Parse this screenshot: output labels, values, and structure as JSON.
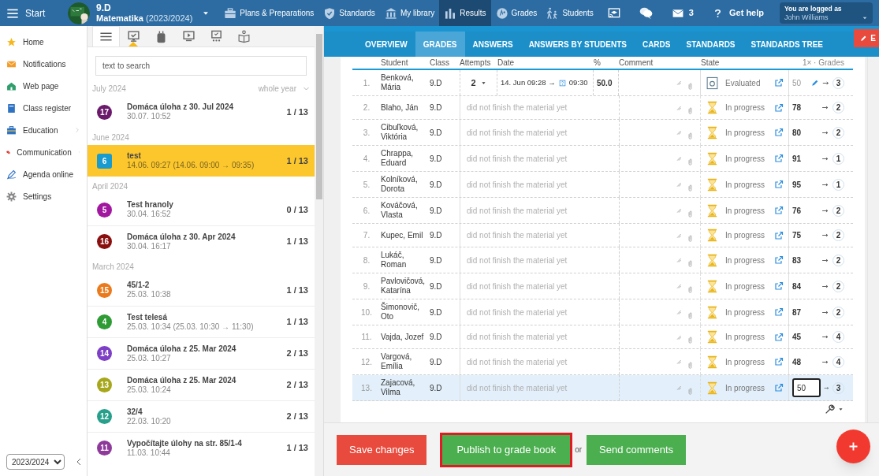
{
  "topbar": {
    "start": "Start",
    "class_name": "9.D",
    "subject": "Matematika",
    "year": "(2023/2024)",
    "nav": [
      {
        "label": "Plans & Preparations",
        "selected": false
      },
      {
        "label": "Standards",
        "selected": false
      },
      {
        "label": "My library",
        "selected": false
      },
      {
        "label": "Results",
        "selected": true
      },
      {
        "label": "Grades",
        "selected": false
      },
      {
        "label": "Students",
        "selected": false
      }
    ],
    "mail_count": "3",
    "help": "Get help",
    "user_caption": "You are logged as",
    "user_name": "John Williams"
  },
  "sidebar": {
    "items": [
      {
        "label": "Home",
        "has_children": false
      },
      {
        "label": "Notifications",
        "has_children": false
      },
      {
        "label": "Web page",
        "has_children": false
      },
      {
        "label": "Class register",
        "has_children": false
      },
      {
        "label": "Education",
        "has_children": true
      },
      {
        "label": "Communication",
        "has_children": true
      },
      {
        "label": "Agenda online",
        "has_children": false
      },
      {
        "label": "Settings",
        "has_children": false
      }
    ],
    "year": "2023/2024"
  },
  "list_panel": {
    "tabs": [
      {
        "selected": true
      },
      {
        "selected": false
      },
      {
        "selected": false
      },
      {
        "selected": false
      },
      {
        "selected": false
      },
      {
        "selected": false
      }
    ],
    "search": {
      "placeholder": "text to search"
    },
    "filter": "whole year",
    "groups": [
      {
        "month": "July 2024",
        "items": [
          {
            "number": "17",
            "color": "#6b1a6b",
            "title": "Domáca úloha z 30. Jul 2024",
            "time": "30.07. 10:52",
            "count": "1 / 13",
            "selected": false
          }
        ]
      },
      {
        "month": "June 2024",
        "items": [
          {
            "number": "6",
            "color": "#1a9bcf",
            "title": "test",
            "time": "14.06. 09:27 (14.06. 09:00 → 09:35)",
            "count": "1 / 13",
            "selected": true
          }
        ]
      },
      {
        "month": "April 2024",
        "items": [
          {
            "number": "5",
            "color": "#a1179f",
            "title": "Test hranoly",
            "time": "30.04. 16:52",
            "count": "0 / 13",
            "selected": false
          },
          {
            "number": "16",
            "color": "#8a1010",
            "title": "Domáca úloha z 30. Apr 2024",
            "time": "30.04. 16:17",
            "count": "1 / 13",
            "selected": false
          }
        ]
      },
      {
        "month": "March 2024",
        "items": [
          {
            "number": "15",
            "color": "#ea7a1c",
            "title": "45/1-2",
            "time": "25.03. 10:38",
            "count": "1 / 13",
            "selected": false
          },
          {
            "number": "4",
            "color": "#2e9b35",
            "title": "Test telesá",
            "time": "25.03. 10:34 (25.03. 10:30 → 11:30)",
            "count": "1 / 13",
            "selected": false
          },
          {
            "number": "14",
            "color": "#7c3fc5",
            "title": "Domáca úloha z 25. Mar 2024",
            "time": "25.03. 10:27",
            "count": "2 / 13",
            "selected": false
          },
          {
            "number": "13",
            "color": "#a6a71a",
            "title": "Domáca úloha z 25. Mar 2024",
            "time": "25.03. 10:24",
            "count": "2 / 13",
            "selected": false
          },
          {
            "number": "12",
            "color": "#27a08b",
            "title": "32/4",
            "time": "22.03. 10:20",
            "count": "2 / 13",
            "selected": false
          },
          {
            "number": "11",
            "color": "#8e3a9b",
            "title": "Vypočítajte úlohy na str. 85/1-4",
            "time": "11.03. 10:44",
            "count": "1 / 13",
            "selected": false
          }
        ]
      }
    ]
  },
  "tabs": [
    {
      "label": "OVERVIEW",
      "selected": false
    },
    {
      "label": "GRADES",
      "selected": true
    },
    {
      "label": "ANSWERS",
      "selected": false
    },
    {
      "label": "ANSWERS BY STUDENTS",
      "selected": false
    },
    {
      "label": "CARDS",
      "selected": false
    },
    {
      "label": "STANDARDS",
      "selected": false
    },
    {
      "label": "STANDARDS TREE",
      "selected": false
    }
  ],
  "edit_button": "E",
  "table": {
    "columns": [
      "Student",
      "Class",
      "Attempts",
      "Date",
      "%",
      "Comment",
      "State",
      "1× · Grades"
    ],
    "rows": [
      {
        "number": "1.",
        "name": "Benková, Mária",
        "class": "9.D",
        "attempt": "2",
        "start": "14. Jun 09:28 →",
        "end": "09:30",
        "percent": "50.0",
        "kind": "evaluated",
        "state": "Evaluated",
        "score": "50",
        "editing": false,
        "grade": "3",
        "selected": false
      },
      {
        "number": "2.",
        "name": "Blaho, Ján",
        "class": "9.D",
        "note": "did not finish the material yet",
        "kind": "pending",
        "state": "In progress",
        "score": "78",
        "editing": false,
        "grade": "2",
        "selected": false
      },
      {
        "number": "3.",
        "name": "Cibuľková, Viktória",
        "class": "9.D",
        "note": "did not finish the material yet",
        "kind": "pending",
        "state": "In progress",
        "score": "80",
        "editing": false,
        "grade": "2",
        "selected": false
      },
      {
        "number": "4.",
        "name": "Chrappa, Eduard",
        "class": "9.D",
        "note": "did not finish the material yet",
        "kind": "pending",
        "state": "In progress",
        "score": "91",
        "editing": false,
        "grade": "1",
        "selected": false
      },
      {
        "number": "5.",
        "name": "Kolníková, Dorota",
        "class": "9.D",
        "note": "did not finish the material yet",
        "kind": "pending",
        "state": "In progress",
        "score": "95",
        "editing": false,
        "grade": "1",
        "selected": false
      },
      {
        "number": "6.",
        "name": "Kováčová, Vlasta",
        "class": "9.D",
        "note": "did not finish the material yet",
        "kind": "pending",
        "state": "In progress",
        "score": "76",
        "editing": false,
        "grade": "2",
        "selected": false
      },
      {
        "number": "7.",
        "name": "Kupec, Emil",
        "class": "9.D",
        "note": "did not finish the material yet",
        "kind": "pending",
        "state": "In progress",
        "score": "75",
        "editing": false,
        "grade": "2",
        "selected": false
      },
      {
        "number": "8.",
        "name": "Lukáč, Roman",
        "class": "9.D",
        "note": "did not finish the material yet",
        "kind": "pending",
        "state": "In progress",
        "score": "83",
        "editing": false,
        "grade": "2",
        "selected": false
      },
      {
        "number": "9.",
        "name": "Pavlovičová, Katarína",
        "class": "9.D",
        "note": "did not finish the material yet",
        "kind": "pending",
        "state": "In progress",
        "score": "84",
        "editing": false,
        "grade": "2",
        "selected": false
      },
      {
        "number": "10.",
        "name": "Šimonovič, Oto",
        "class": "9.D",
        "note": "did not finish the material yet",
        "kind": "pending",
        "state": "In progress",
        "score": "87",
        "editing": false,
        "grade": "2",
        "selected": false
      },
      {
        "number": "11.",
        "name": "Vajda, Jozef",
        "class": "9.D",
        "note": "did not finish the material yet",
        "kind": "pending",
        "state": "In progress",
        "score": "45",
        "editing": false,
        "grade": "4",
        "selected": false
      },
      {
        "number": "12.",
        "name": "Vargová, Emília",
        "class": "9.D",
        "note": "did not finish the material yet",
        "kind": "pending",
        "state": "In progress",
        "score": "48",
        "editing": false,
        "grade": "4",
        "selected": false
      },
      {
        "number": "13.",
        "name": "Zajacová, Vilma",
        "class": "9.D",
        "note": "did not finish the material yet",
        "kind": "pending",
        "state": "In progress",
        "score": "50",
        "editing": true,
        "grade": "3",
        "selected": true
      }
    ]
  },
  "actions": [
    {
      "label": "Save changes",
      "kind": "danger"
    },
    {
      "label": "Publish to grade book",
      "kind": "primary_highlighted"
    },
    {
      "label": "Send comments",
      "kind": "primary"
    }
  ],
  "actions_separator": "or"
}
